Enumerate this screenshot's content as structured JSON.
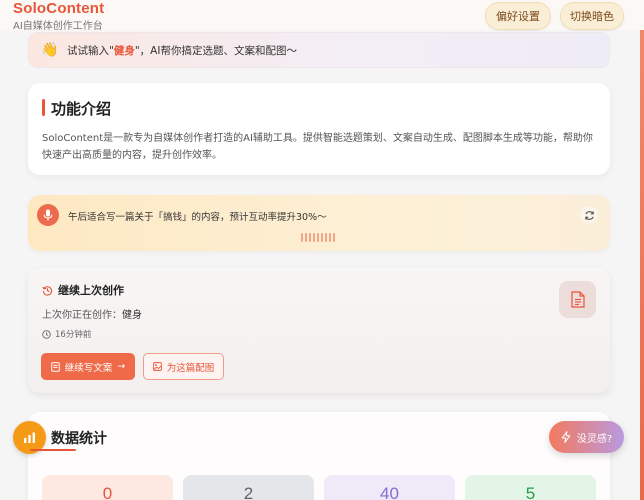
{
  "header": {
    "title": "SoloContent",
    "subtitle": "AI自媒体创作工作台",
    "pref_button": "偏好设置",
    "theme_button": "切换暗色"
  },
  "prompt_banner": {
    "icon": "waving-hand-icon",
    "before": "试试输入\"",
    "highlight": "健身",
    "after": "\"，AI帮你搞定选题、文案和配图～"
  },
  "intro": {
    "title": "功能介绍",
    "description": "SoloContent是一款专为自媒体创作者打造的AI辅助工具。提供智能选题策划、文案自动生成、配图脚本生成等功能，帮助你快速产出高质量的内容，提升创作效率。"
  },
  "voice_tip": {
    "icon": "microphone-icon",
    "text": "午后适合写一篇关于「搞钱」的内容，预计互动率提升30%～",
    "refresh_icon": "refresh-icon"
  },
  "continue": {
    "title": "继续上次创作",
    "label": "上次你正在创作：",
    "topic": "健身",
    "time": "16分钟前",
    "primary_button": "继续写文案",
    "secondary_button": "为这篇配图"
  },
  "stats": {
    "title": "数据统计",
    "values": [
      "0",
      "2",
      "40",
      "5"
    ]
  },
  "float_button": {
    "label": "没灵感?"
  },
  "colors": {
    "accent": "#e8563a",
    "stats_icon": "#f59a16"
  }
}
